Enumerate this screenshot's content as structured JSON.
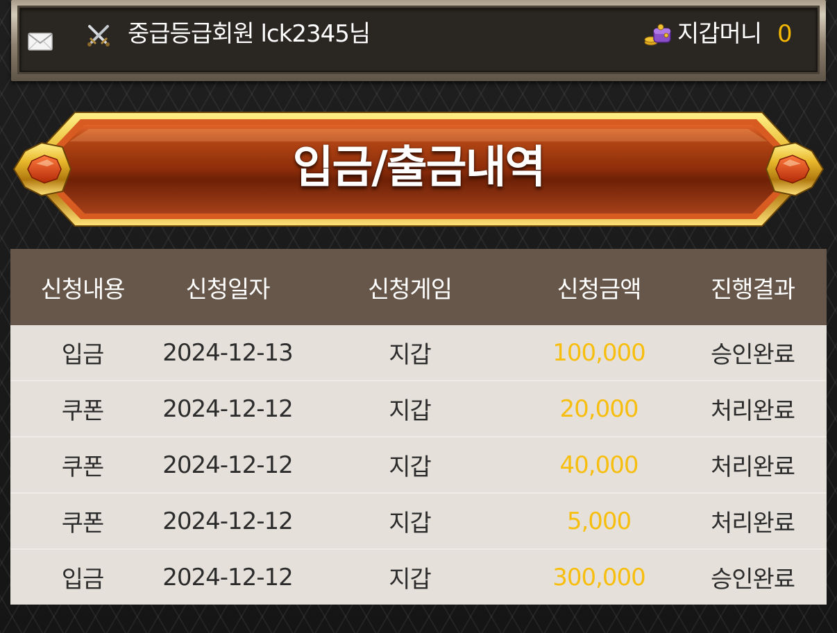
{
  "header": {
    "member_grade_text": "중급등급회원 lck2345님",
    "wallet_label": "지갑머니",
    "wallet_value": "0",
    "icons": [
      "mail-icon",
      "crossed-swords-icon",
      "wallet-coins-icon"
    ]
  },
  "banner": {
    "title": "입금/출금내역"
  },
  "table": {
    "columns": [
      "신청내용",
      "신청일자",
      "신청게임",
      "신청금액",
      "진행결과"
    ],
    "rows": [
      {
        "type": "입금",
        "date": "2024-12-13",
        "game": "지갑",
        "amount": "100,000",
        "result": "승인완료"
      },
      {
        "type": "쿠폰",
        "date": "2024-12-12",
        "game": "지갑",
        "amount": "20,000",
        "result": "처리완료"
      },
      {
        "type": "쿠폰",
        "date": "2024-12-12",
        "game": "지갑",
        "amount": "40,000",
        "result": "처리완료"
      },
      {
        "type": "쿠폰",
        "date": "2024-12-12",
        "game": "지갑",
        "amount": "5,000",
        "result": "처리완료"
      },
      {
        "type": "입금",
        "date": "2024-12-12",
        "game": "지갑",
        "amount": "300,000",
        "result": "승인완료"
      }
    ]
  },
  "colors": {
    "accent_gold": "#f5b800",
    "header_row": "#66574a",
    "row_background": "#e5e0da",
    "banner_red": "#9a3a10"
  }
}
